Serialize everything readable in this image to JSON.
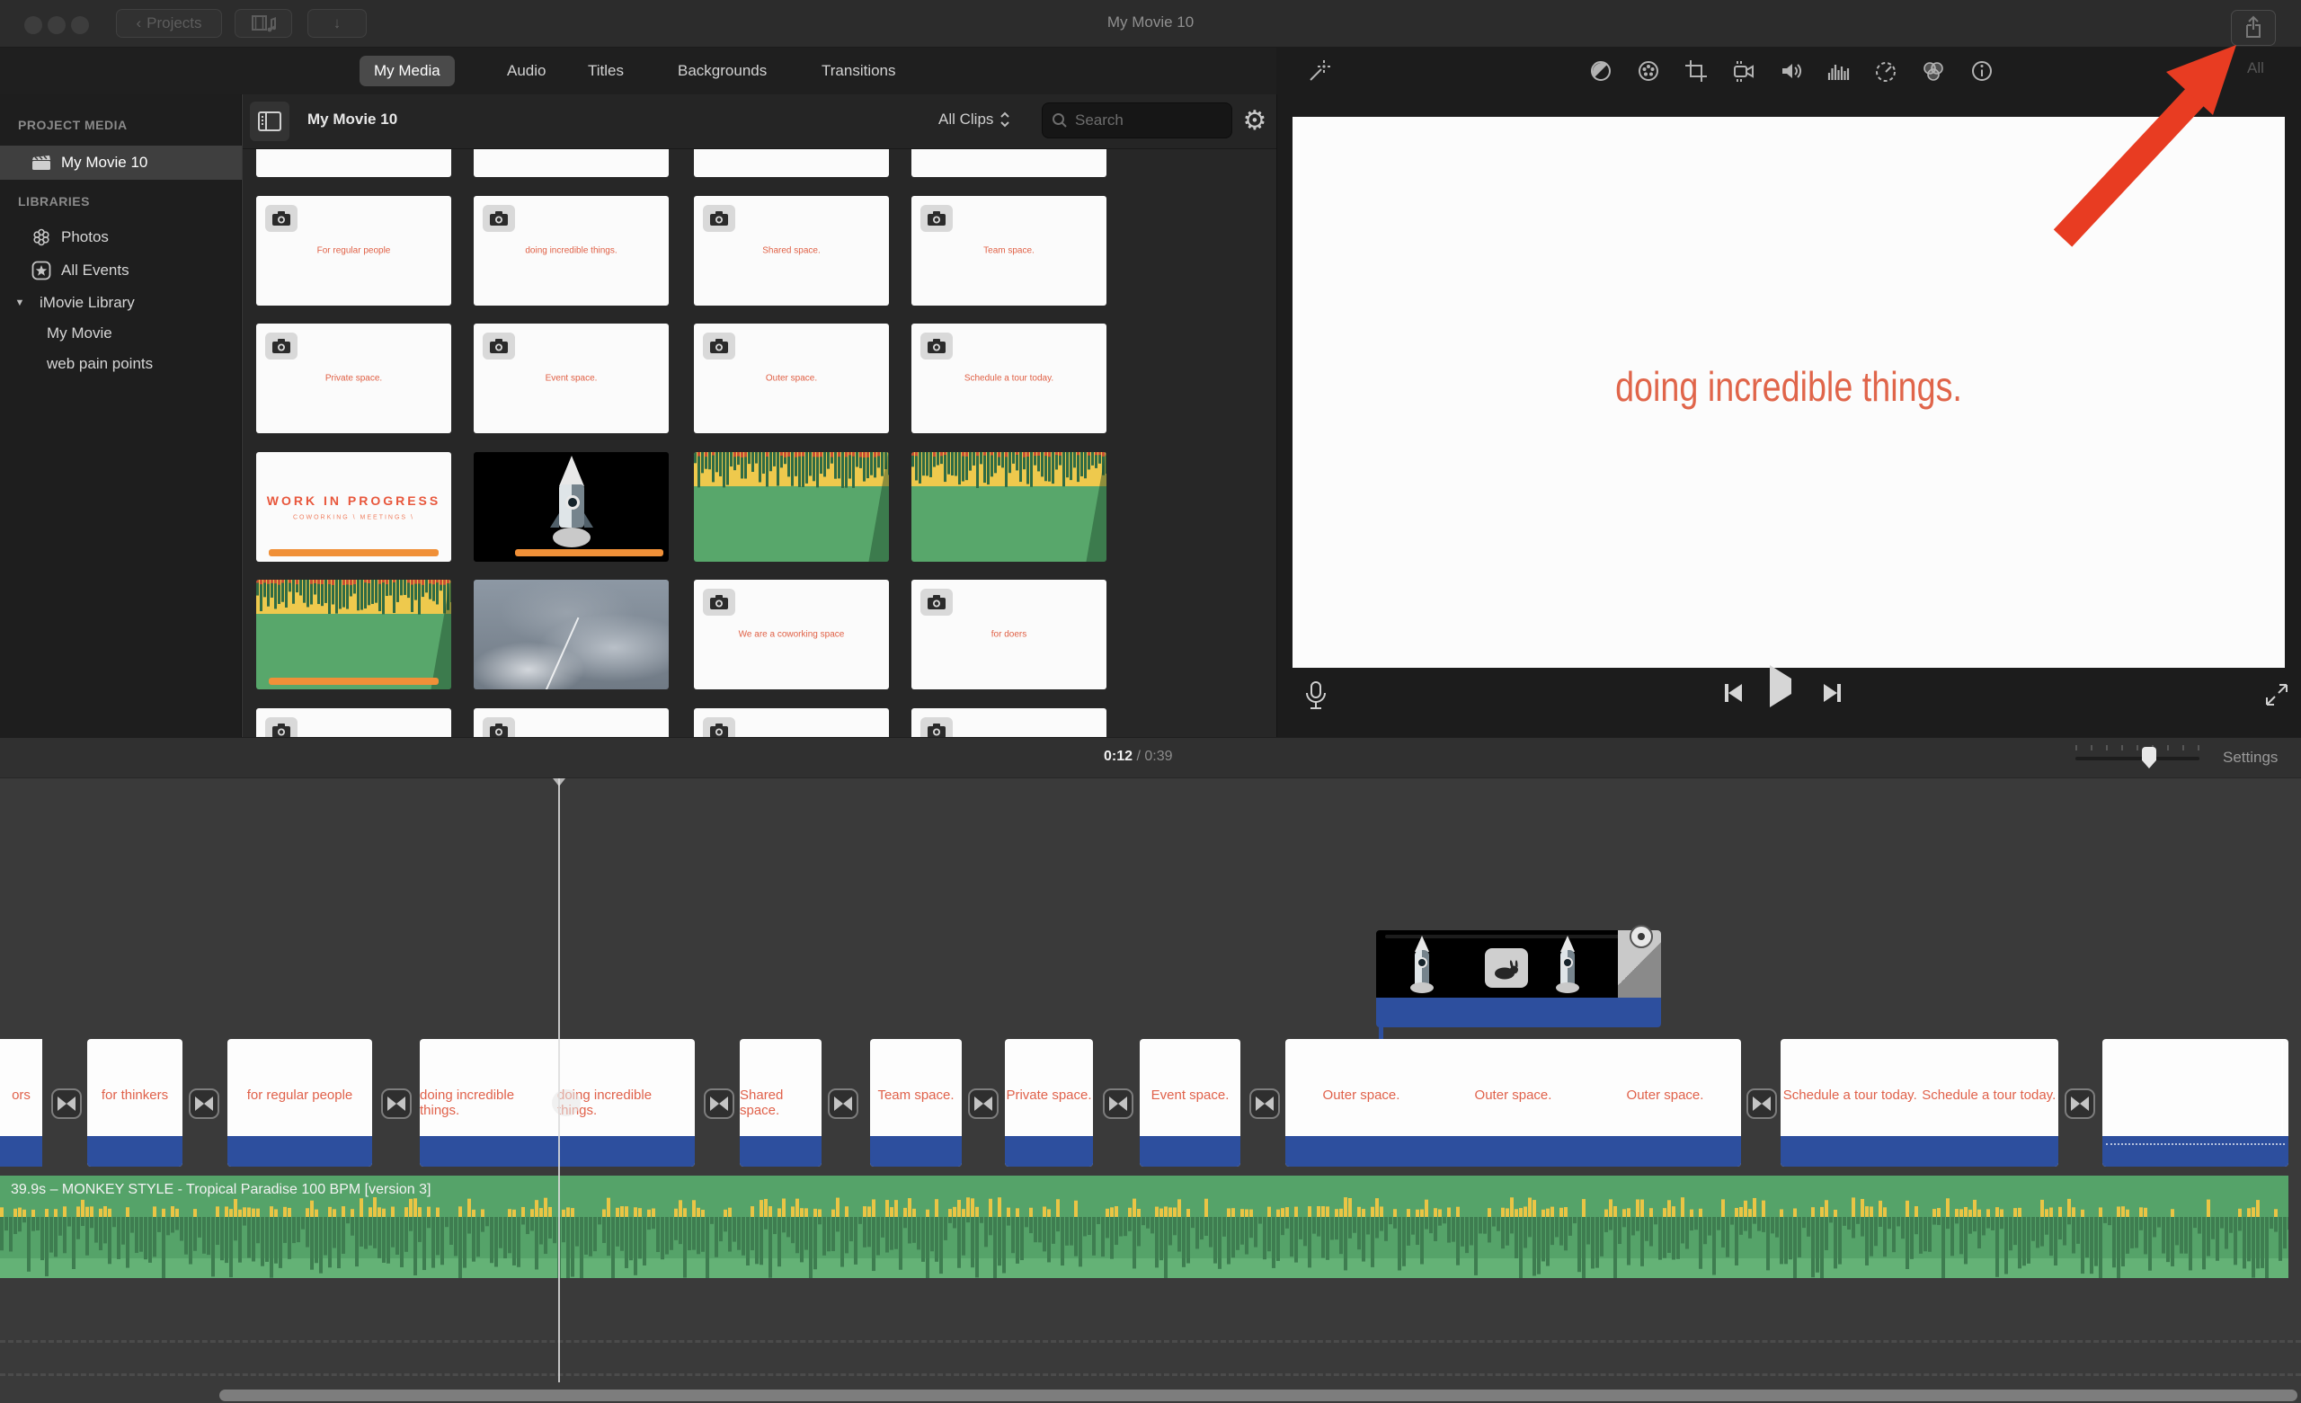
{
  "window": {
    "title": "My Movie 10",
    "toolbar": {
      "projects_label": "Projects"
    }
  },
  "icons_text": {
    "chevron_left": "‹",
    "down_arrow": "↓",
    "gear": "⚙",
    "disclosure": "▼"
  },
  "tabs": {
    "items": [
      "My Media",
      "Audio",
      "Titles",
      "Backgrounds",
      "Transitions"
    ],
    "selected": "My Media"
  },
  "sidebar": {
    "section1": "PROJECT MEDIA",
    "project_item": "My Movie 10",
    "section2": "LIBRARIES",
    "photos": "Photos",
    "all_events": "All Events",
    "imovie_library": "iMovie Library",
    "library_children": [
      "My Movie",
      "web pain points"
    ]
  },
  "browser": {
    "title": "My Movie 10",
    "filter_label": "All Clips",
    "search_placeholder": "Search",
    "row2": [
      "For regular people",
      "doing incredible things.",
      "Shared space.",
      "Team space."
    ],
    "row3": [
      "Private space.",
      "Event space.",
      "Outer space.",
      "Schedule a tour today."
    ],
    "wip_title": "WORK IN PROGRESS",
    "wip_subtitle": "COWORKING \\ MEETINGS \\",
    "row5": [
      "We are a coworking space",
      "for doers"
    ]
  },
  "viewer": {
    "caption": "doing incredible things.",
    "all_label": "All"
  },
  "timeline": {
    "current_time": "0:12",
    "separator": " / ",
    "duration": "0:39",
    "settings_label": "Settings",
    "audio_label": "39.9s – MONKEY STYLE - Tropical Paradise 100 BPM [version 3]",
    "clips": [
      {
        "label": "ors"
      },
      {
        "label": "for thinkers"
      },
      {
        "label": "for regular people"
      },
      {
        "label": "doing incredible things."
      },
      {
        "label": "Shared space."
      },
      {
        "label": "Team space."
      },
      {
        "label": "Private space."
      },
      {
        "label": "Event space."
      },
      {
        "label": "Outer space."
      },
      {
        "label": "Schedule a tour today."
      },
      {
        "label": ""
      }
    ]
  },
  "colors": {
    "clip_bar_blue": "#2d4f9e",
    "audio_green": "#55a369",
    "card_text_red": "#e0614a",
    "orange_bar": "#f09038",
    "arrow_red": "#e83c22",
    "caption_orange": "#e0654a"
  }
}
